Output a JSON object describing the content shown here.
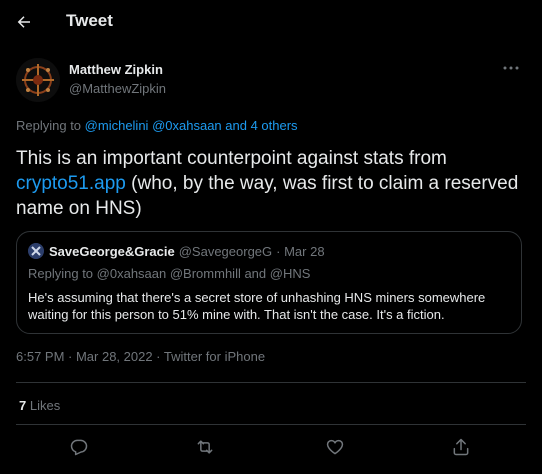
{
  "header": {
    "title": "Tweet"
  },
  "author": {
    "name": "Matthew Zipkin",
    "handle": "@MatthewZipkin"
  },
  "reply": {
    "prefix": "Replying to",
    "mention1": "@michelini",
    "mention2": "@0xahsaan",
    "and_others": "and 4 others"
  },
  "tweet": {
    "text_before": "This is an important counterpoint against stats from",
    "link": "crypto51.app",
    "text_after": "(who, by the way, was first to claim a reserved name on HNS)"
  },
  "quote": {
    "name": "SaveGeorge&Gracie",
    "handle": "@SavegeorgeG",
    "date": "· Mar 28",
    "reply_prefix": "Replying to",
    "reply_mentions": "@0xahsaan @Brommhill and @HNS",
    "text": "He's assuming that there's a secret store of unhashing HNS miners somewhere waiting for this person to 51% mine with. That isn't the case. It's a fiction."
  },
  "meta": {
    "timestamp": "6:57 PM · Mar 28, 2022 · Twitter for iPhone"
  },
  "stats": {
    "likes_count": "7",
    "likes_label": "Likes"
  },
  "colors": {
    "background": "#000000",
    "accent": "#1d9bf0",
    "muted": "#71767b",
    "text": "#e7e9ea",
    "border": "#2f3336"
  },
  "icons": [
    "back-arrow-icon",
    "more-icon",
    "reply-icon",
    "retweet-icon",
    "like-icon",
    "share-icon"
  ]
}
